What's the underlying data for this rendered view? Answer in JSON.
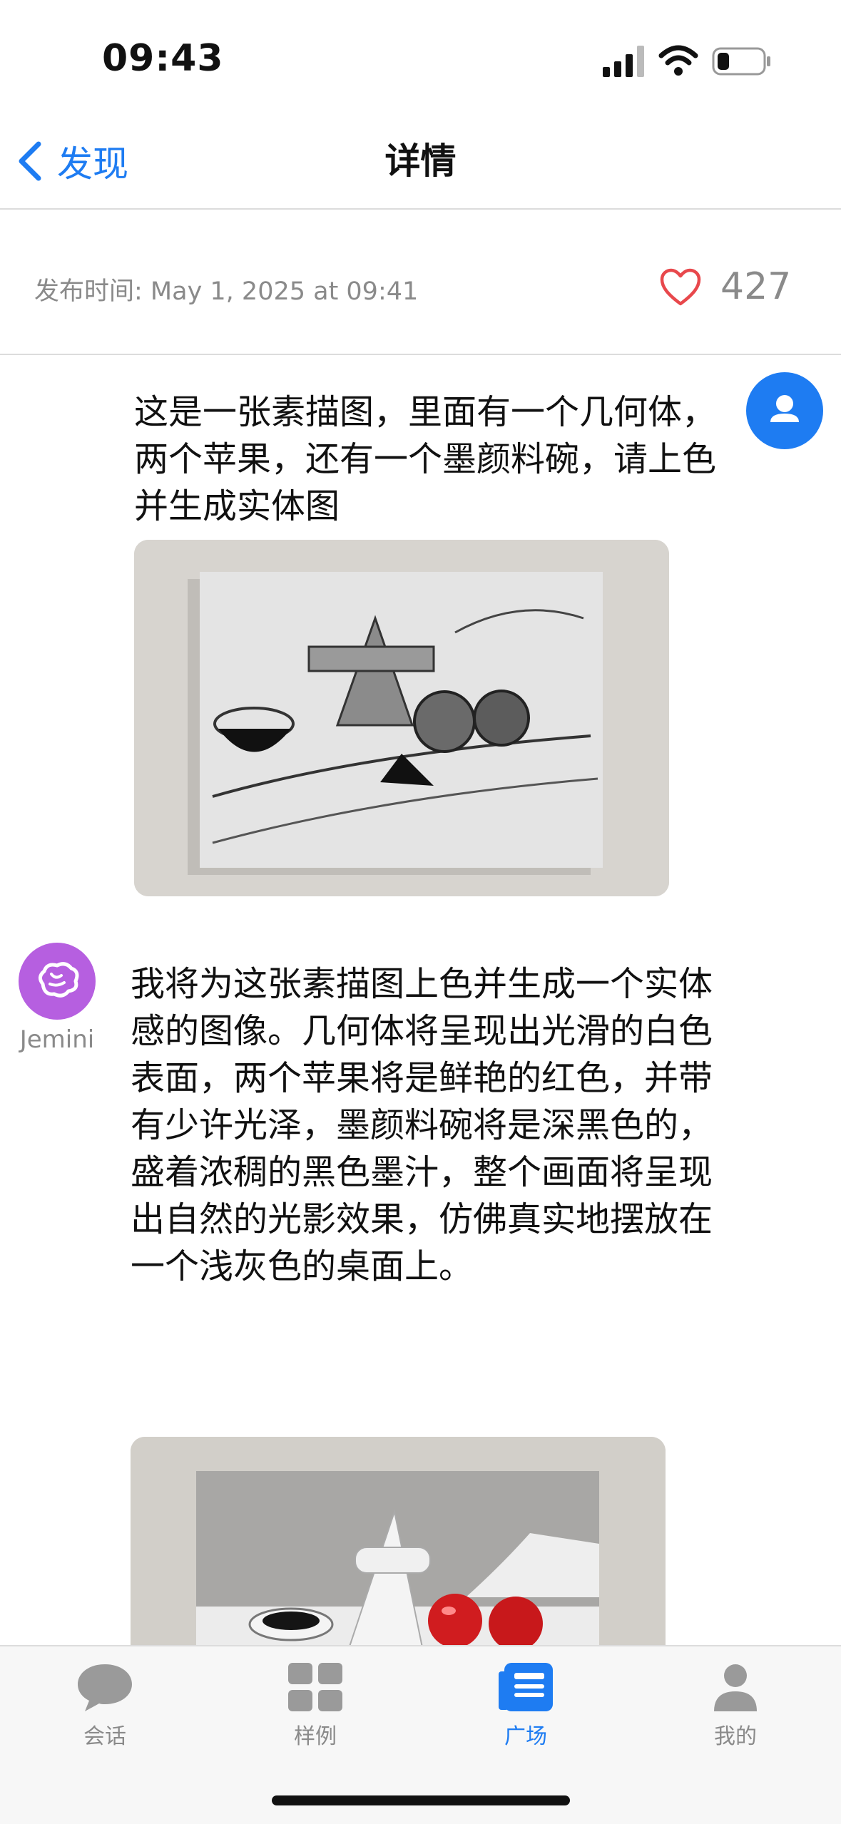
{
  "status_bar": {
    "time": "09:43"
  },
  "nav": {
    "back_label": "发现",
    "title": "详情"
  },
  "post": {
    "publish_time": "发布时间: May 1, 2025 at 09:41",
    "likes": "427"
  },
  "messages": {
    "user_prompt": "这是一张素描图，里面有一个几何体，两个苹果，还有一个墨颜料碗，请上色并生成实体图",
    "ai_name": "Jemini",
    "ai_reply": "我将为这张素描图上色并生成一个实体感的图像。几何体将呈现出光滑的白色表面，两个苹果将是鲜艳的红色，并带有少许光泽，墨颜料碗将是深黑色的，盛着浓稠的黑色墨汁，整个画面将呈现出自然的光影效果，仿佛真实地摆放在一个浅灰色的桌面上。"
  },
  "tabs": [
    {
      "label": "会话",
      "icon": "chat-bubble-icon",
      "active": false
    },
    {
      "label": "样例",
      "icon": "grid-icon",
      "active": false
    },
    {
      "label": "广场",
      "icon": "newspaper-icon",
      "active": true
    },
    {
      "label": "我的",
      "icon": "person-icon",
      "active": false
    }
  ],
  "colors": {
    "accent": "#1e7cf2",
    "like": "#e8484c",
    "ai_avatar": "#b65fe0",
    "muted": "#8a8a8a"
  }
}
